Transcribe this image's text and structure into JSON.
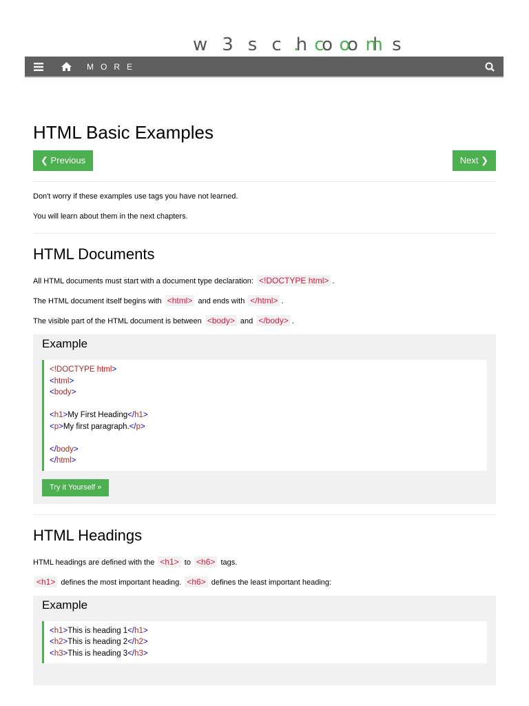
{
  "logo": {
    "text": "w3schools",
    "suffix": ".com"
  },
  "nav": {
    "menu_icon": "hamburger-icon",
    "home_icon": "home-icon",
    "more_label": "MORE",
    "search_icon": "search-icon"
  },
  "page": {
    "title": "HTML Basic Examples",
    "previous_label": "❮ Previous",
    "next_label": "Next ❯",
    "intro": [
      [
        [
          "Don't worry if these examples use tags you have not learned.",
          false
        ]
      ],
      [
        [
          "You will learn about them in the next chapters.",
          false
        ]
      ]
    ],
    "sections": [
      {
        "heading": "HTML Documents",
        "paragraphs": [
          [
            [
              "All HTML documents must start with a document type declaration: ",
              false
            ],
            [
              "<!DOCTYPE html>",
              true
            ],
            [
              ".",
              false
            ]
          ],
          [
            [
              "The HTML document itself begins with ",
              false
            ],
            [
              "<html>",
              true
            ],
            [
              " and ends with ",
              false
            ],
            [
              "</html>",
              true
            ],
            [
              ".",
              false
            ]
          ],
          [
            [
              "The visible part of the HTML document is between ",
              false
            ],
            [
              "<body>",
              true
            ],
            [
              " and ",
              false
            ],
            [
              "</body>",
              true
            ],
            [
              ".",
              false
            ]
          ]
        ],
        "example": {
          "heading": "Example",
          "code": [
            [
              [
                "<!DOCTYPE ",
                "tn"
              ],
              [
                "html",
                "tr"
              ],
              [
                ">",
                "tb"
              ]
            ],
            [
              [
                "<",
                "tb"
              ],
              [
                "html",
                "tn"
              ],
              [
                ">",
                "tb"
              ]
            ],
            [
              [
                "<",
                "tb"
              ],
              [
                "body",
                "tn"
              ],
              [
                ">",
                "tb"
              ]
            ],
            [],
            [
              [
                "<",
                "tb"
              ],
              [
                "h1",
                "tn"
              ],
              [
                ">",
                "tb"
              ],
              [
                "My First Heading",
                "tx"
              ],
              [
                "</",
                "tb"
              ],
              [
                "h1",
                "tn"
              ],
              [
                ">",
                "tb"
              ]
            ],
            [
              [
                "<",
                "tb"
              ],
              [
                "p",
                "tn"
              ],
              [
                ">",
                "tb"
              ],
              [
                "My first paragraph.",
                "tx"
              ],
              [
                "</",
                "tb"
              ],
              [
                "p",
                "tn"
              ],
              [
                ">",
                "tb"
              ]
            ],
            [],
            [
              [
                "</",
                "tb"
              ],
              [
                "body",
                "tn"
              ],
              [
                ">",
                "tb"
              ]
            ],
            [
              [
                "</",
                "tb"
              ],
              [
                "html",
                "tn"
              ],
              [
                ">",
                "tb"
              ]
            ]
          ],
          "button": "Try it Yourself »"
        }
      },
      {
        "heading": "HTML Headings",
        "paragraphs": [
          [
            [
              "HTML headings are defined with the ",
              false
            ],
            [
              "<h1>",
              true
            ],
            [
              " to ",
              false
            ],
            [
              "<h6>",
              true
            ],
            [
              " tags.",
              false
            ]
          ],
          [
            [
              "<h1>",
              true
            ],
            [
              " defines the most important heading. ",
              false
            ],
            [
              "<h6>",
              true
            ],
            [
              " defines the least important heading:",
              false
            ]
          ]
        ],
        "example": {
          "heading": "Example",
          "code": [
            [
              [
                "<",
                "tb"
              ],
              [
                "h1",
                "tn"
              ],
              [
                ">",
                "tb"
              ],
              [
                "This is heading 1",
                "tx"
              ],
              [
                "</",
                "tb"
              ],
              [
                "h1",
                "tn"
              ],
              [
                ">",
                "tb"
              ]
            ],
            [
              [
                "<",
                "tb"
              ],
              [
                "h2",
                "tn"
              ],
              [
                ">",
                "tb"
              ],
              [
                "This is heading 2",
                "tx"
              ],
              [
                "</",
                "tb"
              ],
              [
                "h2",
                "tn"
              ],
              [
                ">",
                "tb"
              ]
            ],
            [
              [
                "<",
                "tb"
              ],
              [
                "h3",
                "tn"
              ],
              [
                ">",
                "tb"
              ],
              [
                "This is heading 3",
                "tx"
              ],
              [
                "</",
                "tb"
              ],
              [
                "h3",
                "tn"
              ],
              [
                ">",
                "tb"
              ]
            ]
          ]
        }
      }
    ]
  }
}
